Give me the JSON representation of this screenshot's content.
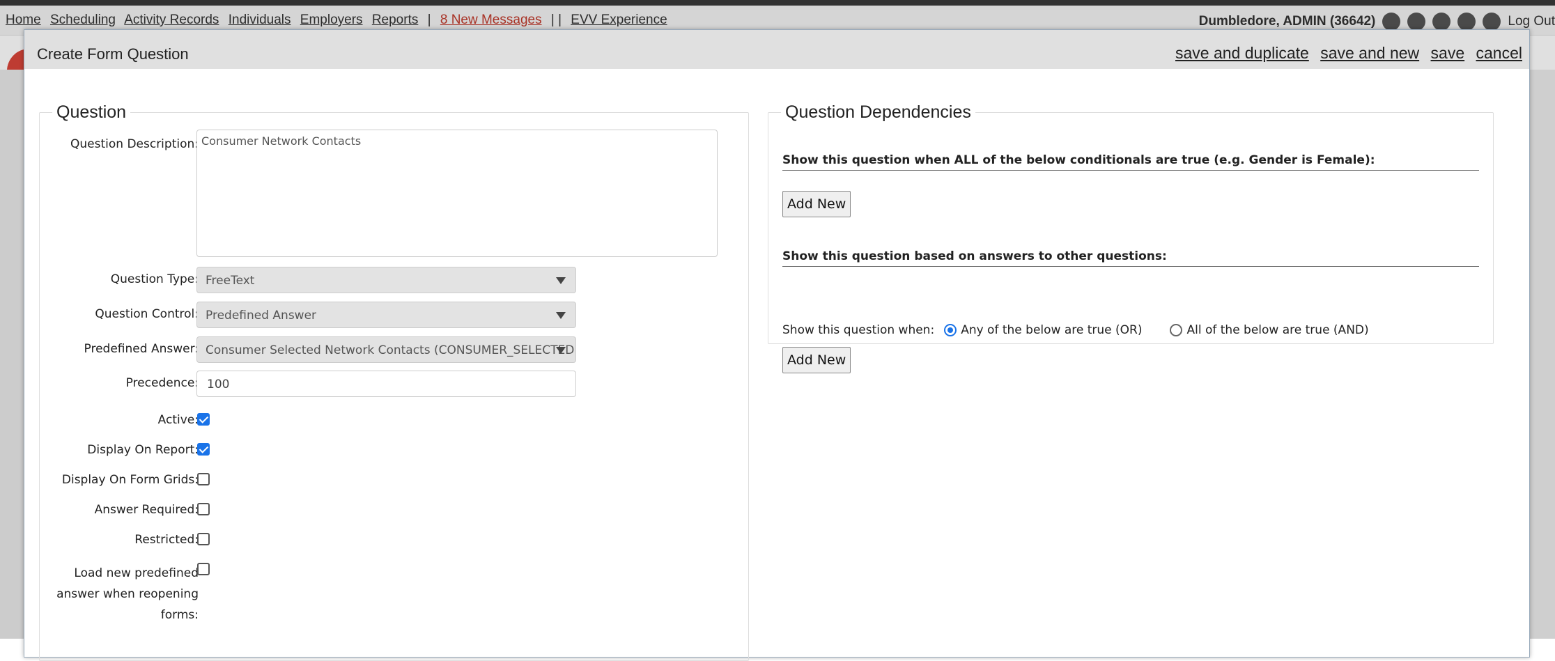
{
  "app": {
    "nav_items": [
      "Home",
      "Scheduling",
      "Activity Records",
      "Individuals",
      "Employers",
      "Reports"
    ],
    "separator": "|",
    "messages": "8 New Messages",
    "separator2": "| |",
    "evv": "EVV Experience",
    "user": "Dumbledore, ADMIN  (36642)",
    "logout": "Log Out",
    "accent_color": "#c0392b"
  },
  "dialog": {
    "title": "Create Form Question",
    "actions": {
      "save_duplicate": "save and duplicate",
      "save_new": "save and new",
      "save": "save",
      "cancel": "cancel"
    }
  },
  "question": {
    "legend": "Question",
    "description_label": "Question Description:",
    "description_value": "Consumer Network Contacts",
    "type_label": "Question Type:",
    "type_value": "FreeText",
    "control_label": "Question Control:",
    "control_value": "Predefined Answer",
    "predef_label": "Predefined Answer:",
    "predef_value": "Consumer Selected Network Contacts (CONSUMER_SELECTED...",
    "precedence_label": "Precedence:",
    "precedence_value": "100",
    "active_label": "Active:",
    "active_checked": true,
    "display_report_label": "Display On Report:",
    "display_report_checked": true,
    "display_grids_label": "Display On Form Grids:",
    "display_grids_checked": false,
    "answer_required_label": "Answer Required:",
    "answer_required_checked": false,
    "restricted_label": "Restricted:",
    "restricted_checked": false,
    "reload_label_1": "Load new predefined",
    "reload_label_2": "answer when reopening",
    "reload_label_3": "forms:",
    "reload_checked": false
  },
  "dependencies": {
    "legend": "Question Dependencies",
    "all_conditions_heading": "Show this question when ALL of the below conditionals are true (e.g. Gender is Female):",
    "add_new_label": "Add New",
    "answers_heading": "Show this question based on answers to other questions:",
    "show_when_label": "Show this question when:",
    "option_or": "Any of the below are true (OR)",
    "option_and": "All of the below are true (AND)",
    "selected_option": "OR"
  }
}
